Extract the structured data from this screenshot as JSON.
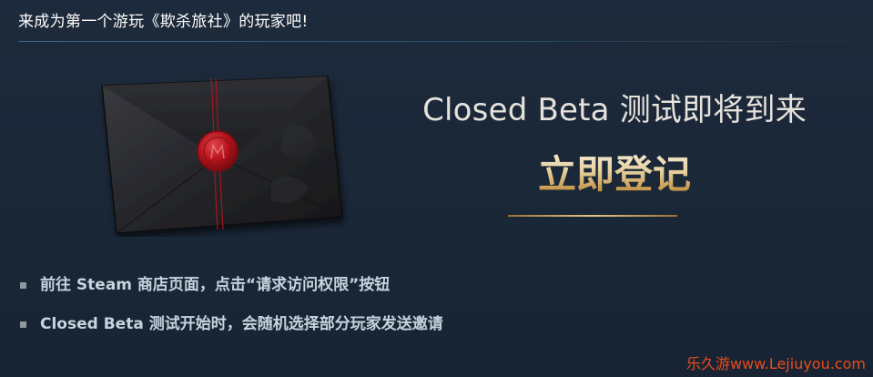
{
  "header": {
    "title": "来成为第一个游玩《欺杀旅社》的玩家吧!"
  },
  "promo": {
    "heading": "Closed Beta 测试即将到来",
    "register_label": "立即登记"
  },
  "bullets": [
    {
      "text": "前往 Steam 商店页面，点击“请求访问权限”按钮"
    },
    {
      "text": "Closed Beta 测试开始时，会随机选择部分玩家发送邀请"
    }
  ],
  "watermark": {
    "text": "乐久游www.Lejiuyou.com"
  },
  "colors": {
    "background": "#1b2838",
    "gold_accent": "#d4b37a",
    "seal_red": "#b3121c",
    "watermark": "#e84b1c"
  }
}
